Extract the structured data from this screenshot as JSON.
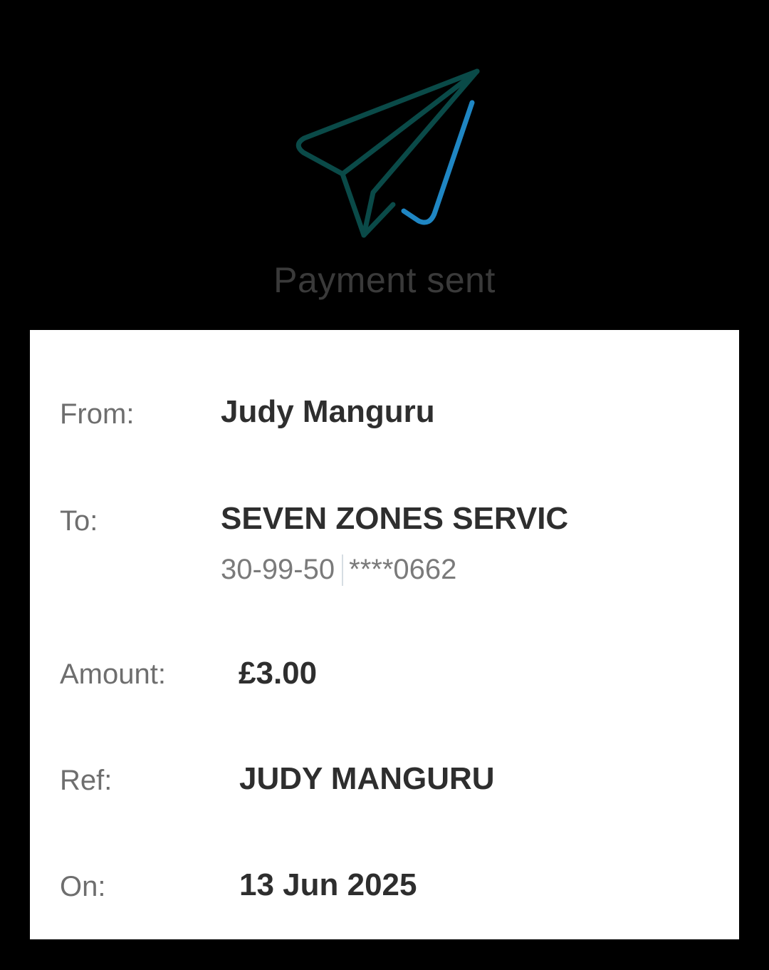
{
  "status": {
    "title": "Payment sent",
    "icon": "paper-plane-icon",
    "icon_colors": {
      "plane": "#0a4a48",
      "trail": "#1f86c3"
    }
  },
  "details": {
    "from": {
      "label": "From:",
      "value": "Judy Manguru"
    },
    "to": {
      "label": "To:",
      "value": "SEVEN ZONES SERVIC",
      "sort_code": "30-99-50",
      "account": "****0662"
    },
    "amount": {
      "label": "Amount:",
      "value": "£3.00"
    },
    "ref": {
      "label": "Ref:",
      "value": "JUDY MANGURU"
    },
    "on": {
      "label": "On:",
      "value": "13 Jun 2025"
    }
  }
}
